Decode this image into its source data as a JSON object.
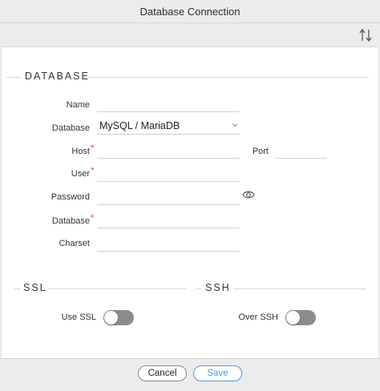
{
  "window": {
    "title": "Database Connection"
  },
  "toolbar": {
    "sort_icon": "sort-arrows-icon"
  },
  "sections": {
    "database": "DATABASE",
    "ssl": "SSL",
    "ssh": "SSH"
  },
  "form": {
    "name": {
      "label": "Name",
      "value": ""
    },
    "database_type": {
      "label": "Database",
      "value": "MySQL / MariaDB"
    },
    "host": {
      "label": "Host",
      "value": "",
      "required": "*"
    },
    "port": {
      "label": "Port",
      "value": ""
    },
    "user": {
      "label": "User",
      "value": "",
      "required": "*"
    },
    "password": {
      "label": "Password",
      "value": "",
      "icon": "eye-icon"
    },
    "database": {
      "label": "Database",
      "value": "",
      "required": "*"
    },
    "charset": {
      "label": "Charset",
      "value": ""
    }
  },
  "ssl": {
    "use_ssl_label": "Use SSL",
    "use_ssl_on": false
  },
  "ssh": {
    "over_ssh_label": "Over SSH",
    "over_ssh_on": false
  },
  "footer": {
    "cancel_label": "Cancel",
    "save_label": "Save"
  },
  "colors": {
    "required": "#e0403f",
    "primary": "#4f9ae6",
    "toggle_off": "#8c8c8c"
  }
}
